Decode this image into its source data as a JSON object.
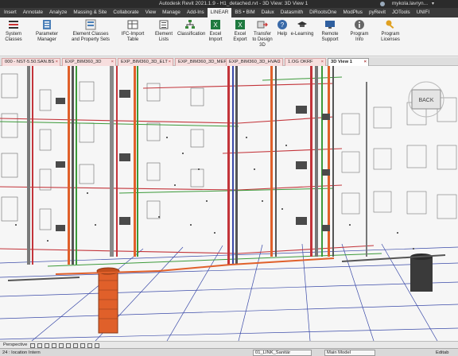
{
  "app": {
    "title": "Autodesk Revit 2021.1.9 - H1_detached.rvt - 3D View: 3D View 1",
    "user": "mykola.lavryn..."
  },
  "ribbon_tabs": [
    "Insert",
    "Annotate",
    "Analyze",
    "Massing & Site",
    "Collaborate",
    "View",
    "Manage",
    "Add-Ins",
    "LINEAR",
    "BS • BIM",
    "Dalux",
    "Datasmith",
    "DiRootsOne",
    "ModPlus",
    "pyRevit",
    "JOTools",
    "UNIFI"
  ],
  "active_ribbon_tab": "LINEAR",
  "ribbon_buttons": [
    {
      "label": "System Classes",
      "icon": "list-icon"
    },
    {
      "label": "Parameter Manager",
      "icon": "parameter-icon"
    },
    {
      "label": "Element Classes and Property Sets",
      "icon": "classes-icon"
    },
    {
      "label": "IFC-Import Table",
      "icon": "table-icon"
    },
    {
      "label": "Element Lists",
      "icon": "list-icon"
    },
    {
      "label": "Classification",
      "icon": "tree-icon"
    },
    {
      "label": "Excel Import",
      "icon": "excel-icon"
    },
    {
      "label": "Excel Export",
      "icon": "excel-icon"
    },
    {
      "label": "Transfer to Design 3D",
      "icon": "transfer-icon"
    },
    {
      "label": "Help",
      "icon": "help-icon"
    },
    {
      "label": "e-Learning",
      "icon": "graduation-icon"
    },
    {
      "label": "Remote Support",
      "icon": "remote-icon"
    },
    {
      "label": "Program Info",
      "icon": "info-icon"
    },
    {
      "label": "Program Licenses",
      "icon": "key-icon"
    }
  ],
  "doc_tabs": [
    "000 - NST-5.50.SAN.BS",
    "EXP_BIM360_3D",
    "EXP_BIM360_3D_ELT",
    "EXP_BIM360_3D_MEP",
    "EXP_BIM360_3D_HVAC",
    "1.OG OKRF",
    "3D View 1"
  ],
  "active_doc_tab": "3D View 1",
  "viewcube": {
    "label": "BACK"
  },
  "view_control": {
    "label": "Perspective"
  },
  "status": {
    "left": "24 : location Intern",
    "workset": "01_LINK_Sanitär",
    "model": "Main Model",
    "editable": "Editab"
  },
  "colors": {
    "pipe_orange": "#e0602a",
    "pipe_red": "#c3343a",
    "pipe_green": "#3c9a3a",
    "duct_gray": "#555555",
    "grid_blue": "#3a4aa8"
  }
}
